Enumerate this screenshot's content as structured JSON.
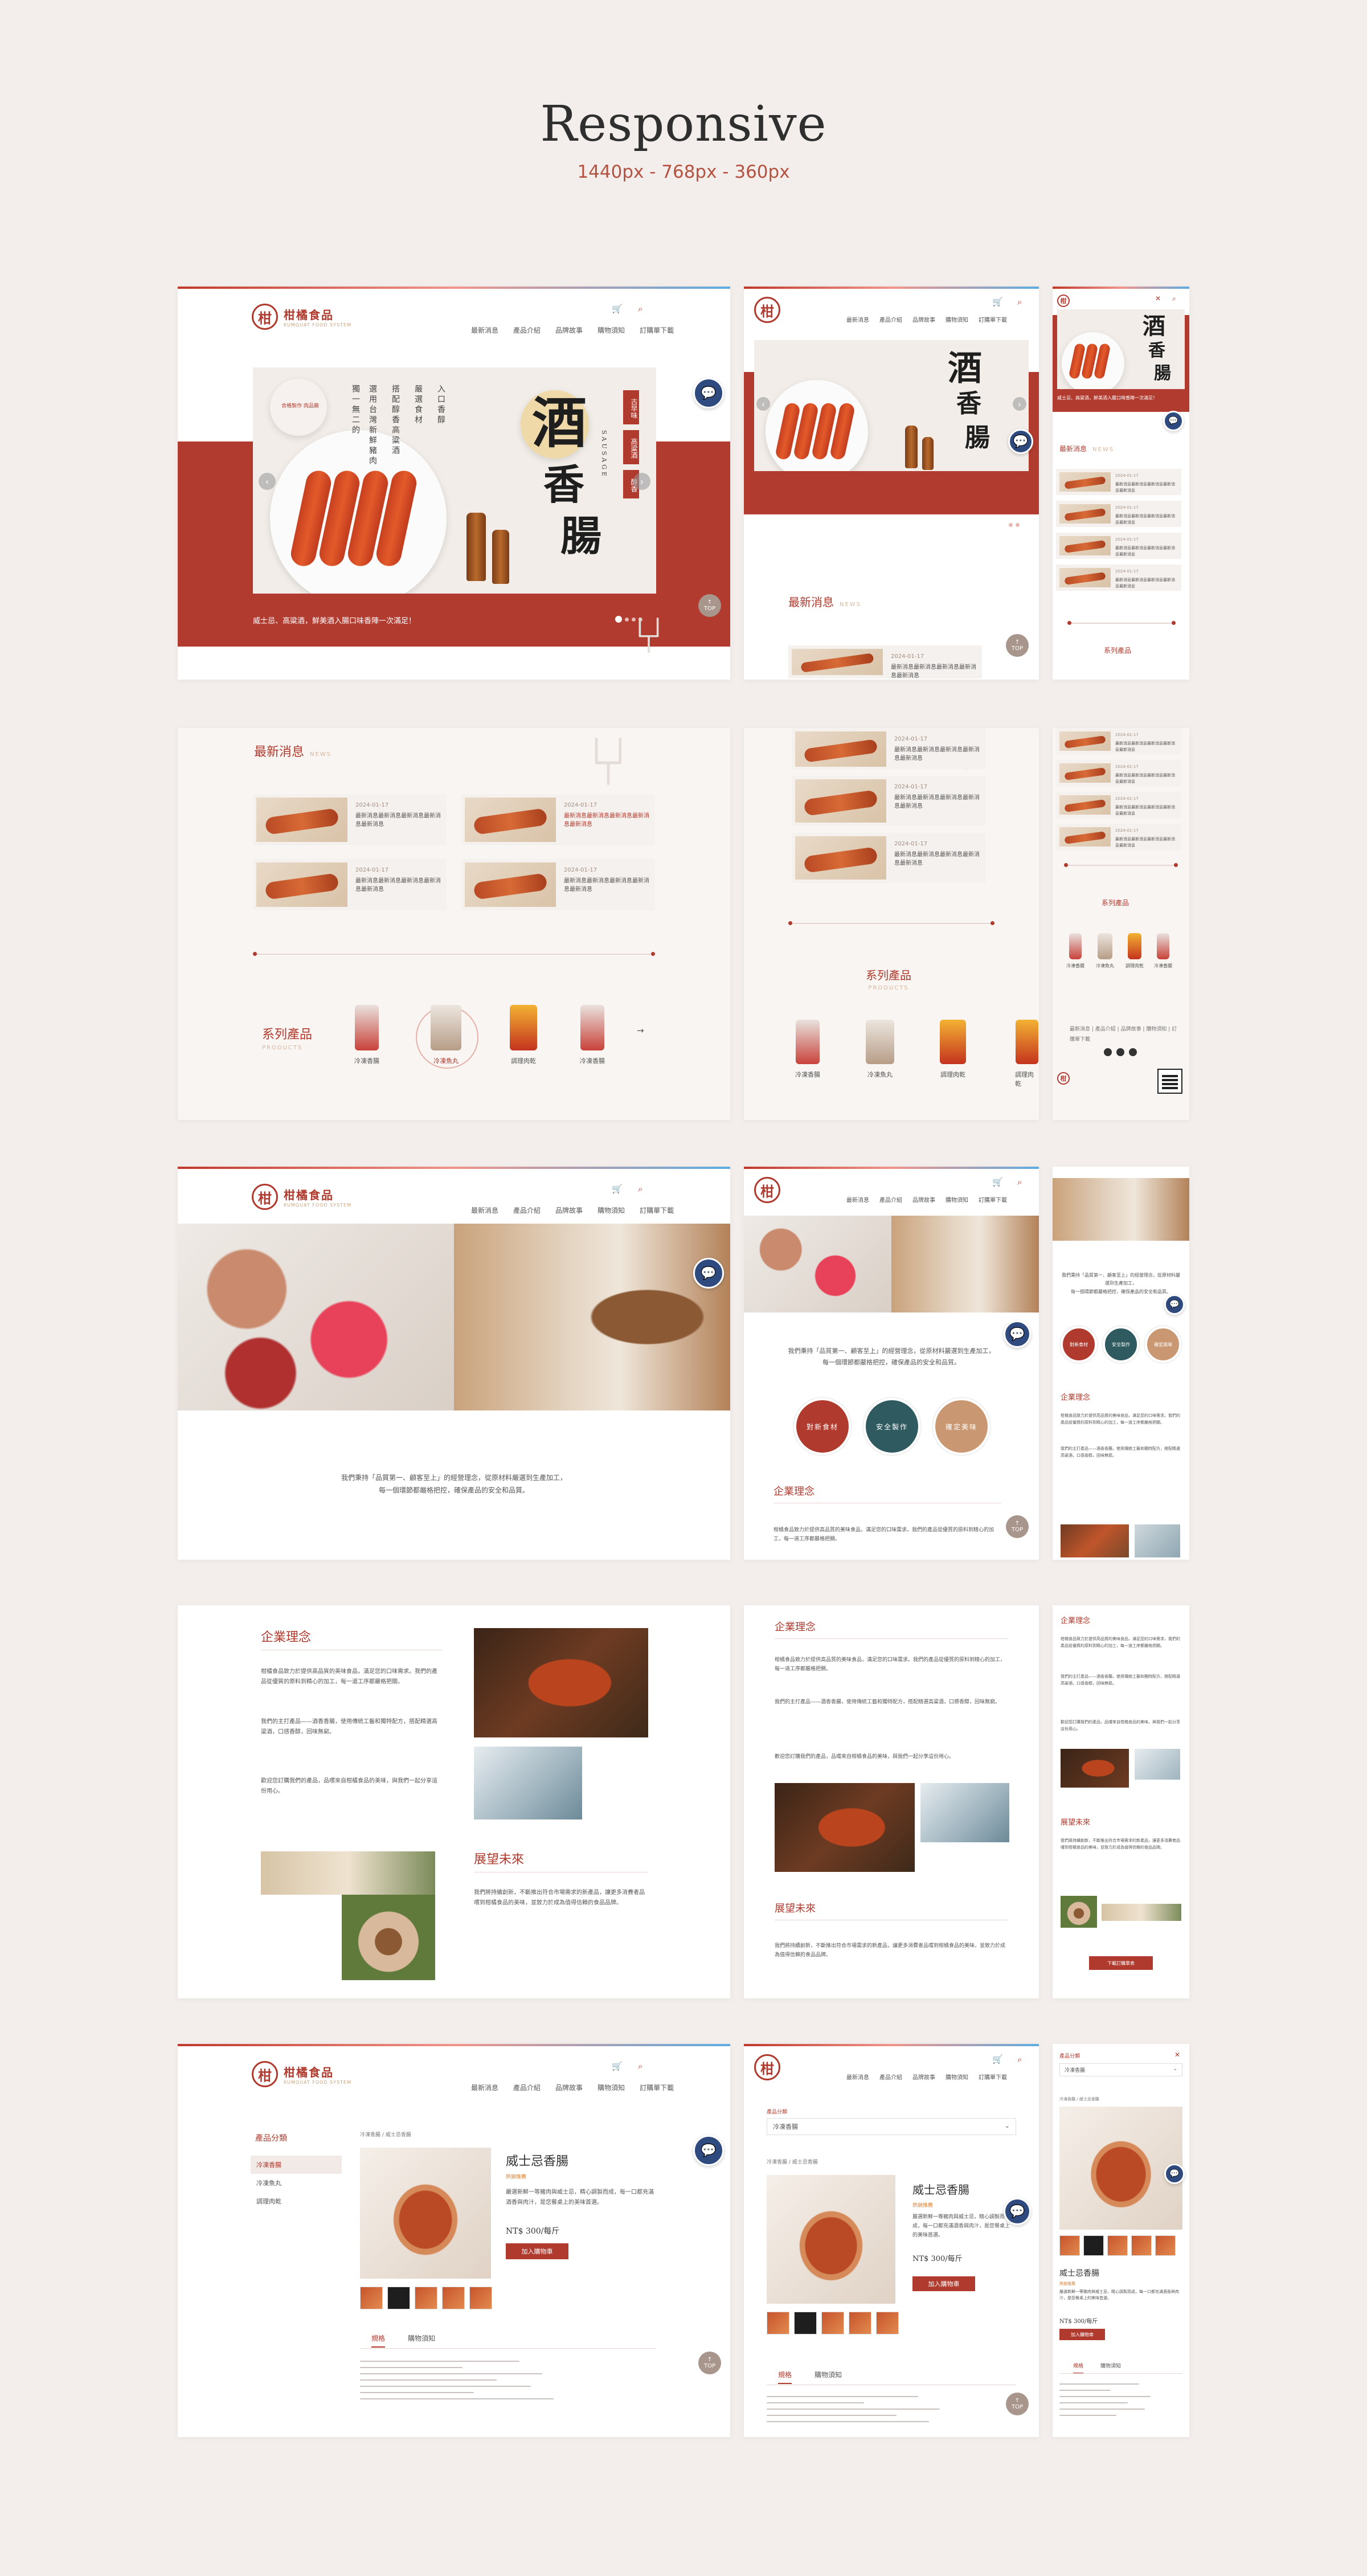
{
  "header": {
    "title": "Responsive",
    "subtitle": "1440px  - 768px - 360px"
  },
  "brand": {
    "name": "柑橘食品",
    "en": "KUMQUAT FOOD SYSTEM",
    "mark": "柑"
  },
  "nav": [
    "最新消息",
    "產品介紹",
    "品牌故事",
    "購物須知",
    "訂購單下載"
  ],
  "icons": {
    "cart": "cart-icon",
    "search": "search-icon",
    "close": "close-icon",
    "chat": "chat-icon"
  },
  "banner": {
    "title1": "酒",
    "title2": "香",
    "title3": "腸",
    "en": "SAUSAGE",
    "v1": "獨一無二的",
    "v2": "選用台灣新鮮豬肉",
    "v3": "搭配醇香高粱酒",
    "v4": "嚴選食材",
    "v5": "入口香醇",
    "stamp1": "古早味",
    "stamp2": "高粱酒",
    "stamp3": "醇香",
    "badge": "合格製作 肉品廠",
    "caption": "威士忌、高粱酒，鮮美酒入腸口味香陣一次滿足！",
    "top": "TOP"
  },
  "news": {
    "title": "最新消息",
    "en": "NEWS",
    "items": [
      {
        "date": "2024-01-17",
        "text": "最新消息最新消息最新消息最新消息最新消息"
      },
      {
        "date": "2024-01-17",
        "text": "最新消息最新消息最新消息最新消息最新消息"
      },
      {
        "date": "2024-01-17",
        "text": "最新消息最新消息最新消息最新消息最新消息"
      },
      {
        "date": "2024-01-17",
        "text": "最新消息最新消息最新消息最新消息最新消息"
      }
    ]
  },
  "products": {
    "title": "系列產品",
    "en": "PRODUCTS",
    "items": [
      "冷凍香腸",
      "冷凍魚丸",
      "調理肉乾",
      "冷凍香腸"
    ]
  },
  "footer": {
    "links": [
      "最新消息",
      "產品介紹",
      "品牌故事",
      "購物須知",
      "訂購單下載"
    ]
  },
  "about": {
    "intro1": "我們秉持「品質第一、顧客至上」的經營理念，從原材料嚴選到生產加工，",
    "intro2": "每一個環節都嚴格把控，確保產品的安全和品質。",
    "circles": [
      "對新食材",
      "安全製作",
      "確定美味"
    ],
    "philosophy": "企業理念",
    "p1": "柑橘食品致力於提供高品質的美味食品，滿足您的口味需求。我們的產品從優質的原料到精心的加工，每一道工序都嚴格把關。",
    "p2": "我們的主打產品——酒香香腸，使用傳統工藝和獨特配方，搭配精選高粱酒，口感香醇，回味無窮。",
    "p3": "歡迎您訂購我們的產品，品嚐來自柑橘食品的美味，與我們一起分享這份用心。",
    "future": "展望未來",
    "f1": "我們將持續創新，不斷推出符合市場需求的新產品，讓更多消費者品嚐到柑橘食品的美味，並致力於成為值得信賴的食品品牌。",
    "orderBtn": "下載訂購單表"
  },
  "detail": {
    "category": "產品分類",
    "cats": [
      "冷凍香腸",
      "冷凍魚丸",
      "調理肉乾"
    ],
    "crumb": "冷凍香腸  /  威士忌香腸",
    "name": "威士忌香腸",
    "tag": "熱銷推薦",
    "desc": "嚴選新鮮一等豬肉與威士忌，精心調製而成，每一口都充滿酒香與肉汁，是您餐桌上的美味首選。",
    "price": "NT$ 300/每斤",
    "btn": "加入購物車",
    "tabs": [
      "規格",
      "購物須知"
    ],
    "select": "冷凍香腸"
  }
}
